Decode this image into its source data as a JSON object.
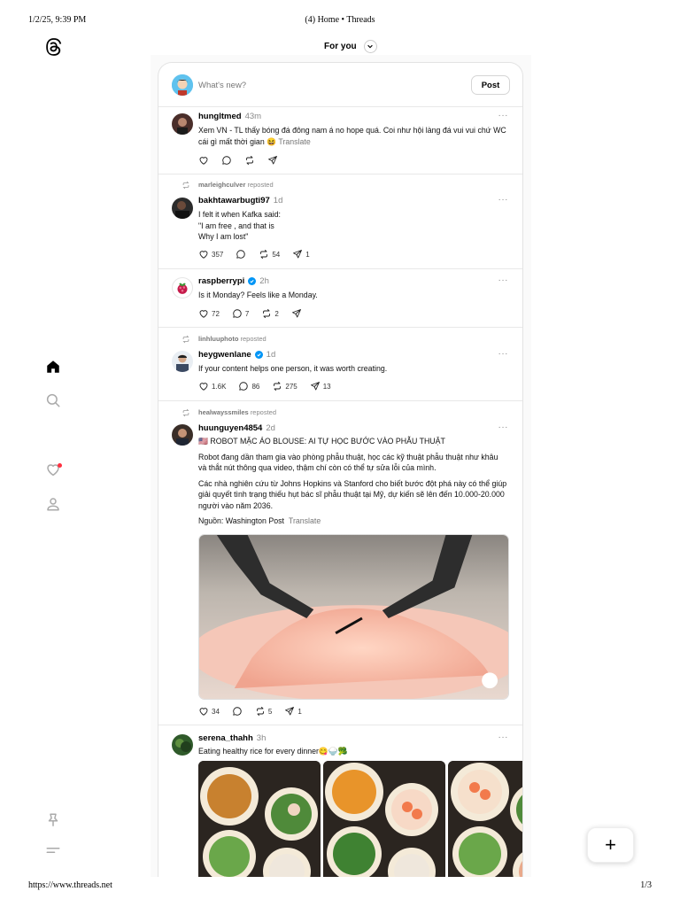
{
  "print": {
    "datetime": "1/2/25, 9:39 PM",
    "title": "(4) Home • Threads",
    "url": "https://www.threads.net",
    "page": "1/3"
  },
  "feed_selector": {
    "label": "For you"
  },
  "composer": {
    "placeholder": "What's new?",
    "post_label": "Post"
  },
  "posts": [
    {
      "username": "hungltmed",
      "time": "43m",
      "text": "Xem VN - TL thấy bóng đá đông nam á no hope quá. Coi như hội làng đá vui vui chứ WC cái gì mất thời gian 😆",
      "translate": "Translate"
    },
    {
      "reposted_by": "marleighculver",
      "reposted_label": "reposted",
      "username": "bakhtawarbugti97",
      "time": "1d",
      "lines": [
        "I felt it when Kafka said:",
        "\"I am free , and that is",
        "Why I am lost\""
      ],
      "likes": "357",
      "replies": "",
      "reposts": "54",
      "shares": "1"
    },
    {
      "username": "raspberrypi",
      "verified": true,
      "time": "2h",
      "text": "Is it Monday? Feels like a Monday.",
      "likes": "72",
      "replies": "7",
      "reposts": "2",
      "shares": ""
    },
    {
      "reposted_by": "linhluuphoto",
      "reposted_label": "reposted",
      "username": "heygwenlane",
      "verified": true,
      "time": "1d",
      "text": "If your content helps one person, it was worth creating.",
      "likes": "1.6K",
      "replies": "86",
      "reposts": "275",
      "shares": "13"
    },
    {
      "reposted_by": "healwayssmiles",
      "reposted_label": "reposted",
      "username": "huunguyen4854",
      "time": "2d",
      "headline": "🇺🇸 ROBOT MẶC ÁO BLOUSE: AI TỰ HỌC BƯỚC VÀO PHẪU THUẬT",
      "para1": "Robot đang dần tham gia vào phòng phẫu thuật, học các kỹ thuật phẫu thuật như khâu và thắt nút thông qua video, thậm chí còn có thể tự sửa lỗi của mình.",
      "para2": "Các nhà nghiên cứu từ Johns Hopkins và Stanford cho biết bước đột phá này có thể giúp giải quyết tình trạng thiếu hụt bác sĩ phẫu thuật tại Mỹ, dự kiến sẽ lên đến 10.000-20.000 người vào năm 2036.",
      "source": "Nguồn: Washington Post",
      "translate": "Translate",
      "likes": "34",
      "replies": "",
      "reposts": "5",
      "shares": "1"
    },
    {
      "username": "serena_thahh",
      "time": "3h",
      "text": "Eating healthy rice for every dinner😋🍚🥦"
    }
  ],
  "icons": {
    "logo": "threads-logo",
    "nav": [
      "home-icon",
      "search-icon",
      "heart-icon",
      "profile-icon",
      "pin-icon",
      "menu-icon"
    ],
    "fab": "plus-icon"
  },
  "colors": {
    "verified": "#0095f6",
    "notification_dot": "#ff3040"
  },
  "more_glyph": "···",
  "fab_glyph": "+"
}
